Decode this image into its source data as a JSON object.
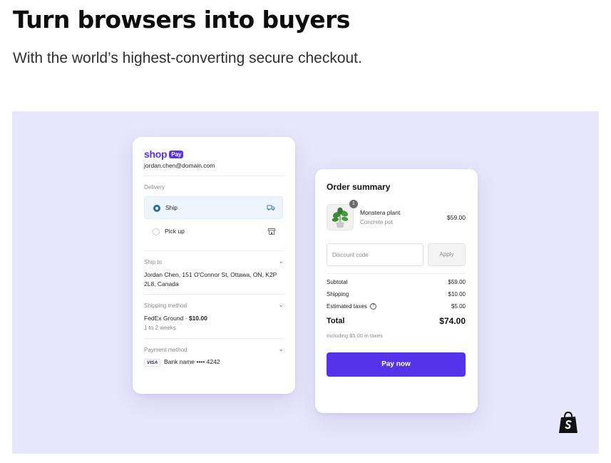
{
  "hero": {
    "headline": "Turn browsers into buyers",
    "subheadline": "With the world’s highest-converting secure checkout."
  },
  "colors": {
    "panel_bg": "#e8e6fc",
    "shop_purple": "#5a31f4",
    "pay_button": "#5433eb"
  },
  "checkout_card": {
    "shop_logo_word": "shop",
    "shop_logo_badge": "Pay",
    "email": "jordan.chen@domain.com",
    "delivery_label": "Delivery",
    "options": [
      {
        "label": "Ship",
        "selected": true,
        "icon": "truck-icon"
      },
      {
        "label": "Pick up",
        "selected": false,
        "icon": "store-icon"
      }
    ],
    "ship_to_label": "Ship to",
    "address": "Jordan Chen, 151 O'Connor St, Ottawa, ON, K2P 2L8, Canada",
    "shipping_method_label": "Shipping method",
    "shipping_method_name": "FedEx Ground · ",
    "shipping_method_price": "$10.00",
    "shipping_method_eta": "1 to 2 weeks",
    "payment_method_label": "Payment method",
    "card_brand": "VISA",
    "card_text": "Bank name •••• 4242"
  },
  "order_summary": {
    "title": "Order summary",
    "item": {
      "quantity": "1",
      "name": "Monstera plant",
      "variant": "Concrete pot",
      "price": "$59.00"
    },
    "discount_placeholder": "Discount code",
    "apply_label": "Apply",
    "subtotal_label": "Subtotal",
    "subtotal_value": "$59.00",
    "shipping_label": "Shipping",
    "shipping_value": "$10.00",
    "taxes_label": "Estimated taxes",
    "taxes_value": "$5.00",
    "total_label": "Total",
    "total_value": "$74.00",
    "tax_note": "Including $5.00 in taxes",
    "pay_label": "Pay now"
  }
}
